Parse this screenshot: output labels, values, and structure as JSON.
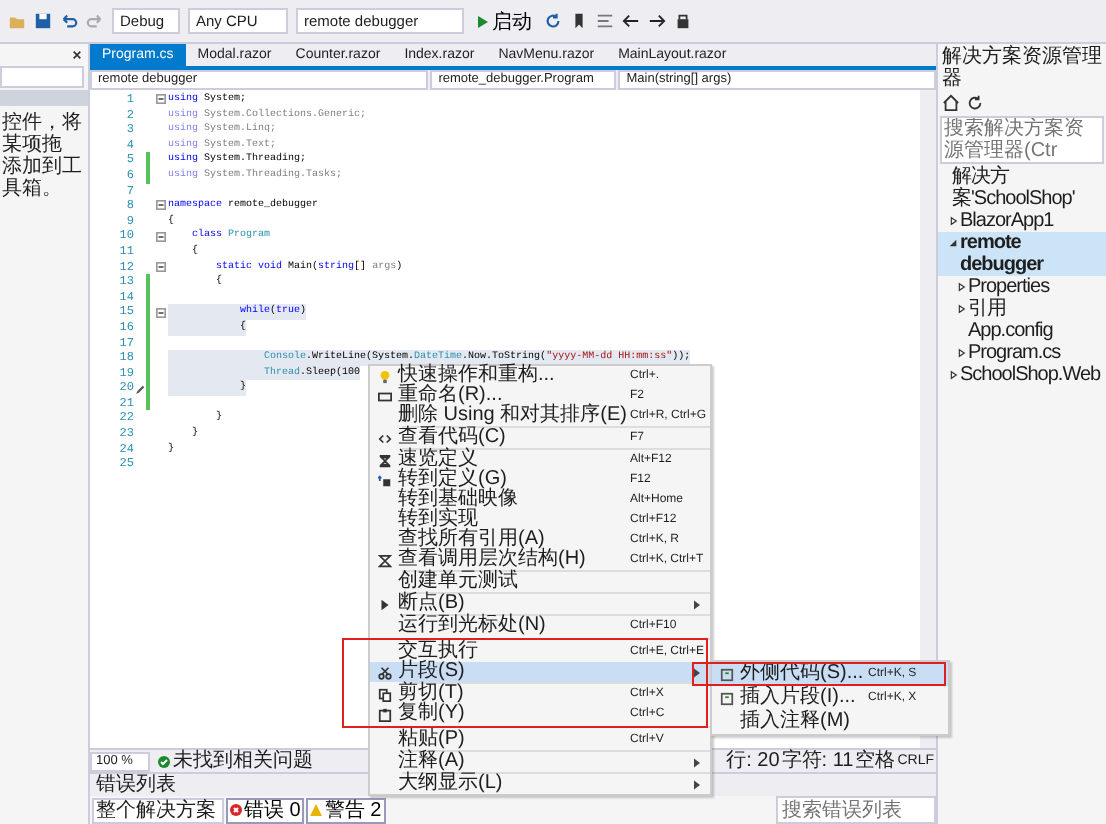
{
  "toolbar": {
    "configuration": "Debug",
    "platform": "Any CPU",
    "startup_project": "remote debugger",
    "start_button": "启动"
  },
  "toolbox": {
    "hint_lines": [
      "控件，将某项拖",
      "添加到工具箱。"
    ]
  },
  "tabs": [
    {
      "label": "Program.cs",
      "selected": true
    },
    {
      "label": "Modal.razor",
      "selected": false
    },
    {
      "label": "Counter.razor",
      "selected": false
    },
    {
      "label": "Index.razor",
      "selected": false
    },
    {
      "label": "NavMenu.razor",
      "selected": false
    },
    {
      "label": "MainLayout.razor",
      "selected": false
    }
  ],
  "nav_bar": {
    "project": "remote debugger",
    "type": "remote_debugger.Program",
    "member": "Main(string[] args)"
  },
  "editor": {
    "lines": [
      {
        "number": "1",
        "tokens": [
          {
            "t": "using",
            "kind": "keyword"
          },
          {
            "t": " System;",
            "kind": "plain"
          }
        ],
        "faded": false,
        "changed": false,
        "highlighted": false,
        "foldable": true,
        "edited": false
      },
      {
        "number": "2",
        "tokens": [
          {
            "t": "using",
            "kind": "keyword"
          },
          {
            "t": " System.Collections.Generic;",
            "kind": "plain"
          }
        ],
        "faded": true,
        "changed": false,
        "highlighted": false,
        "foldable": false,
        "edited": false
      },
      {
        "number": "3",
        "tokens": [
          {
            "t": "using",
            "kind": "keyword"
          },
          {
            "t": " System.Linq;",
            "kind": "plain"
          }
        ],
        "faded": true,
        "changed": false,
        "highlighted": false,
        "foldable": false,
        "edited": false
      },
      {
        "number": "4",
        "tokens": [
          {
            "t": "using",
            "kind": "keyword"
          },
          {
            "t": " System.Text;",
            "kind": "plain"
          }
        ],
        "faded": true,
        "changed": false,
        "highlighted": false,
        "foldable": false,
        "edited": false
      },
      {
        "number": "5",
        "tokens": [
          {
            "t": "using",
            "kind": "keyword"
          },
          {
            "t": " System.Threading;",
            "kind": "plain"
          }
        ],
        "faded": false,
        "changed": true,
        "highlighted": false,
        "foldable": false,
        "edited": false
      },
      {
        "number": "6",
        "tokens": [
          {
            "t": "using",
            "kind": "keyword"
          },
          {
            "t": " System.Threading.Tasks;",
            "kind": "plain"
          }
        ],
        "faded": true,
        "changed": true,
        "highlighted": false,
        "foldable": false,
        "edited": false
      },
      {
        "number": "7",
        "faded": false,
        "changed": false,
        "highlighted": false,
        "foldable": false,
        "edited": false
      },
      {
        "number": "8",
        "tokens": [
          {
            "t": "namespace",
            "kind": "keyword"
          },
          {
            "t": " remote_debugger",
            "kind": "plain"
          }
        ],
        "faded": false,
        "changed": false,
        "highlighted": false,
        "foldable": true,
        "edited": false
      },
      {
        "number": "9",
        "tokens": [
          {
            "t": "{",
            "kind": "plain"
          }
        ],
        "faded": false,
        "changed": false,
        "highlighted": false,
        "foldable": false,
        "edited": false
      },
      {
        "number": "10",
        "tokens": [
          {
            "t": "    class",
            "kind": "keyword"
          },
          {
            "t": " Program",
            "kind": "type"
          }
        ],
        "faded": false,
        "changed": false,
        "highlighted": false,
        "foldable": true,
        "edited": false
      },
      {
        "number": "11",
        "tokens": [
          {
            "t": "    {",
            "kind": "plain"
          }
        ],
        "faded": false,
        "changed": false,
        "highlighted": false,
        "foldable": false,
        "edited": false
      },
      {
        "number": "12",
        "tokens": [
          {
            "t": "        static void",
            "kind": "keyword"
          },
          {
            "t": " Main(",
            "kind": "plain"
          },
          {
            "t": "string",
            "kind": "keyword"
          },
          {
            "t": "[] ",
            "kind": "plain"
          },
          {
            "t": "args",
            "kind": "unused"
          },
          {
            "t": ")",
            "kind": "plain"
          }
        ],
        "faded": false,
        "changed": false,
        "highlighted": false,
        "foldable": true,
        "edited": false
      },
      {
        "number": "13",
        "tokens": [
          {
            "t": "        {",
            "kind": "plain"
          }
        ],
        "faded": false,
        "changed": true,
        "highlighted": false,
        "foldable": false,
        "edited": false
      },
      {
        "number": "14",
        "faded": false,
        "changed": true,
        "highlighted": false,
        "foldable": false,
        "edited": false
      },
      {
        "number": "15",
        "tokens": [
          {
            "t": "            while",
            "kind": "keyword"
          },
          {
            "t": "(",
            "kind": "plain"
          },
          {
            "t": "true",
            "kind": "keyword"
          },
          {
            "t": ")",
            "kind": "plain"
          }
        ],
        "faded": false,
        "changed": true,
        "highlighted": true,
        "foldable": true,
        "edited": false
      },
      {
        "number": "16",
        "tokens": [
          {
            "t": "            {",
            "kind": "plain"
          }
        ],
        "faded": false,
        "changed": true,
        "highlighted": true,
        "foldable": false,
        "edited": false
      },
      {
        "number": "17",
        "faded": false,
        "changed": true,
        "highlighted": false,
        "foldable": false,
        "edited": false
      },
      {
        "number": "18",
        "tokens": [
          {
            "t": "                Console",
            "kind": "type"
          },
          {
            "t": ".WriteLine(System.",
            "kind": "plain"
          },
          {
            "t": "DateTime",
            "kind": "type"
          },
          {
            "t": ".Now.ToString(",
            "kind": "plain"
          },
          {
            "t": "\"yyyy-MM-dd HH:mm:ss\"",
            "kind": "string"
          },
          {
            "t": "));",
            "kind": "plain"
          }
        ],
        "faded": false,
        "changed": true,
        "highlighted": true,
        "foldable": false,
        "edited": false
      },
      {
        "number": "19",
        "tokens": [
          {
            "t": "                Thread",
            "kind": "type"
          },
          {
            "t": ".Sleep(100",
            "kind": "plain"
          }
        ],
        "faded": false,
        "changed": true,
        "highlighted": true,
        "foldable": false,
        "edited": false
      },
      {
        "number": "20",
        "tokens": [
          {
            "t": "            }",
            "kind": "plain"
          }
        ],
        "faded": false,
        "changed": true,
        "highlighted": true,
        "foldable": false,
        "edited": true
      },
      {
        "number": "21",
        "faded": false,
        "changed": true,
        "highlighted": false,
        "foldable": false,
        "edited": false
      },
      {
        "number": "22",
        "tokens": [
          {
            "t": "        }",
            "kind": "plain"
          }
        ],
        "faded": false,
        "changed": false,
        "highlighted": false,
        "foldable": false,
        "edited": false
      },
      {
        "number": "23",
        "tokens": [
          {
            "t": "    }",
            "kind": "plain"
          }
        ],
        "faded": false,
        "changed": false,
        "highlighted": false,
        "foldable": false,
        "edited": false
      },
      {
        "number": "24",
        "tokens": [
          {
            "t": "}",
            "kind": "plain"
          }
        ],
        "faded": false,
        "changed": false,
        "highlighted": false,
        "foldable": false,
        "edited": false
      },
      {
        "number": "25",
        "faded": false,
        "changed": false,
        "highlighted": false,
        "foldable": false,
        "edited": false
      }
    ]
  },
  "context_menu": {
    "items": [
      {
        "kind": "item",
        "label": "快速操作和重构...",
        "shortcut": "Ctrl+.",
        "submenu": false,
        "selected": false,
        "framed": false
      },
      {
        "kind": "item",
        "label": "重命名(R)...",
        "shortcut": "F2",
        "submenu": false,
        "selected": false,
        "framed": false
      },
      {
        "kind": "item",
        "label": "删除 Using 和对其排序(E)",
        "shortcut": "Ctrl+R, Ctrl+G",
        "submenu": false,
        "selected": false,
        "framed": false
      },
      {
        "kind": "separator"
      },
      {
        "kind": "item",
        "label": "查看代码(C)",
        "shortcut": "F7",
        "submenu": false,
        "selected": false,
        "framed": false
      },
      {
        "kind": "separator"
      },
      {
        "kind": "item",
        "label": "速览定义",
        "shortcut": "Alt+F12",
        "submenu": false,
        "selected": false,
        "framed": false
      },
      {
        "kind": "item",
        "label": "转到定义(G)",
        "shortcut": "F12",
        "submenu": false,
        "selected": false,
        "framed": false
      },
      {
        "kind": "item",
        "label": "转到基础映像",
        "shortcut": "Alt+Home",
        "submenu": false,
        "selected": false,
        "framed": false
      },
      {
        "kind": "item",
        "label": "转到实现",
        "shortcut": "Ctrl+F12",
        "submenu": false,
        "selected": false,
        "framed": false
      },
      {
        "kind": "item",
        "label": "查找所有引用(A)",
        "shortcut": "Ctrl+K, R",
        "submenu": false,
        "selected": false,
        "framed": false
      },
      {
        "kind": "item",
        "label": "查看调用层次结构(H)",
        "shortcut": "Ctrl+K, Ctrl+T",
        "submenu": false,
        "selected": false,
        "framed": false
      },
      {
        "kind": "separator"
      },
      {
        "kind": "item",
        "label": "创建单元测试",
        "submenu": false,
        "selected": false,
        "framed": false
      },
      {
        "kind": "separator"
      },
      {
        "kind": "item",
        "label": "断点(B)",
        "submenu": true,
        "selected": false,
        "framed": false
      },
      {
        "kind": "separator"
      },
      {
        "kind": "item",
        "label": "运行到光标处(N)",
        "shortcut": "Ctrl+F10",
        "submenu": false,
        "selected": false,
        "framed": false
      },
      {
        "kind": "separator"
      },
      {
        "kind": "item",
        "label": "交互执行",
        "shortcut": "Ctrl+E, Ctrl+E",
        "submenu": false,
        "selected": false,
        "framed": true
      },
      {
        "kind": "item",
        "label": "片段(S)",
        "submenu": true,
        "selected": true,
        "framed": true
      },
      {
        "kind": "separator"
      },
      {
        "kind": "item",
        "label": "剪切(T)",
        "shortcut": "Ctrl+X",
        "submenu": false,
        "selected": false,
        "framed": true
      },
      {
        "kind": "item",
        "label": "复制(Y)",
        "shortcut": "Ctrl+C",
        "submenu": false,
        "selected": false,
        "framed": true
      },
      {
        "kind": "separator"
      },
      {
        "kind": "item",
        "label": "粘贴(P)",
        "shortcut": "Ctrl+V",
        "submenu": false,
        "selected": false,
        "framed": false
      },
      {
        "kind": "separator"
      },
      {
        "kind": "item",
        "label": "注释(A)",
        "submenu": true,
        "selected": false,
        "framed": false
      },
      {
        "kind": "separator"
      },
      {
        "kind": "item",
        "label": "大纲显示(L)",
        "submenu": true,
        "selected": false,
        "framed": false
      }
    ],
    "submenu": [
      {
        "label": "外侧代码(S)...",
        "shortcut": "Ctrl+K, S",
        "selected": true,
        "framed": true
      },
      {
        "label": "插入片段(I)...",
        "shortcut": "Ctrl+K, X",
        "selected": false,
        "framed": false
      },
      {
        "label": "插入注释(M)",
        "selected": false,
        "framed": false
      }
    ]
  },
  "status_bar": {
    "zoom": "100 %",
    "issues": "未找到相关问题",
    "line": "行: 20",
    "column": "字符: 11",
    "whitespace": "空格",
    "line_ending": "CRLF"
  },
  "error_list": {
    "title": "错误列表",
    "scope": "整个解决方案",
    "errors": "错误 0",
    "warnings": "警告 2",
    "search_placeholder": "搜索错误列表"
  },
  "solution_explorer": {
    "title": "解决方案资源管理器",
    "search_placeholder": "搜索解决方案资源管理器(Ctr",
    "tree": [
      {
        "label": "解决方案'SchoolShop'",
        "selected": false,
        "children": [
          {
            "label": "BlazorApp1",
            "expanded": false,
            "selected": false
          },
          {
            "label": "remote debugger",
            "expanded": true,
            "selected": true,
            "children": [
              {
                "label": "Properties",
                "expanded": false,
                "selected": false
              },
              {
                "label": "引用",
                "expanded": false,
                "selected": false
              },
              {
                "label": "App.config",
                "selected": false
              },
              {
                "label": "Program.cs",
                "expanded": false,
                "selected": false
              }
            ]
          },
          {
            "label": "SchoolShop.Web",
            "expanded": false,
            "selected": false
          }
        ]
      }
    ]
  }
}
